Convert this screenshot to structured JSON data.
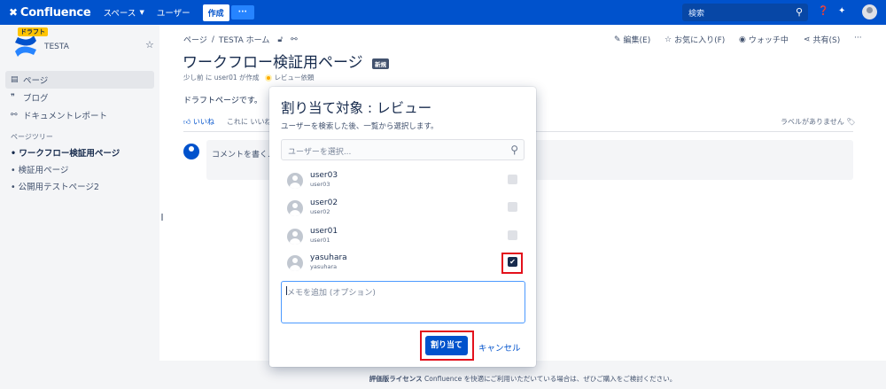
{
  "topnav": {
    "logo": "Confluence",
    "spaces": "スペース",
    "people": "ユーザー",
    "create": "作成",
    "more": "···",
    "search_placeholder": "検索"
  },
  "sidebar": {
    "draft_badge": "ドラフト",
    "space_name": "TESTA",
    "items": [
      {
        "label": "ページ",
        "icon": "page-icon"
      },
      {
        "label": "ブログ",
        "icon": "quote-icon"
      },
      {
        "label": "ドキュメントレポート",
        "icon": "tree-icon"
      }
    ],
    "tree_heading": "ページツリー",
    "tree_items": [
      "ワークフロー検証用ページ",
      "検証用ページ",
      "公開用テストページ2"
    ]
  },
  "page": {
    "breadcrumb": [
      "ページ",
      "/",
      "TESTA ホーム"
    ],
    "actions": {
      "edit": "編集(E)",
      "favorite": "お気に入り(F)",
      "watch": "ウォッチ中",
      "share": "共有(S)",
      "more": "···"
    },
    "title": "ワークフロー検証用ページ",
    "new_badge": "新規",
    "byline": "少し前 に user01 が作成",
    "review_label": "レビュー依頼",
    "body": "ドラフトページです。",
    "like": "いいね",
    "like_note": "これに いいね",
    "labels_none": "ラベルがありません",
    "comment_placeholder": "コメントを書く..."
  },
  "footer": {
    "license_bold": "評価版ライセンス",
    "license_text": " Confluence を快適にご利用いただいている場合は、ぜひご購入をご検討ください。"
  },
  "dialog": {
    "title": "割り当て対象 : レビュー",
    "subtitle": "ユーザーを検索した後、一覧から選択します。",
    "search_placeholder": "ユーザーを選択...",
    "users": [
      {
        "name": "user03",
        "id": "user03",
        "checked": false
      },
      {
        "name": "user02",
        "id": "user02",
        "checked": false
      },
      {
        "name": "user01",
        "id": "user01",
        "checked": false
      },
      {
        "name": "yasuhara",
        "id": "yasuhara",
        "checked": true
      }
    ],
    "memo_placeholder": "メモを追加 (オプション)",
    "assign": "割り当て",
    "cancel": "キャンセル"
  },
  "colors": {
    "brand": "#0052cc",
    "highlight": "#e3111c",
    "draft": "#ffc400"
  }
}
